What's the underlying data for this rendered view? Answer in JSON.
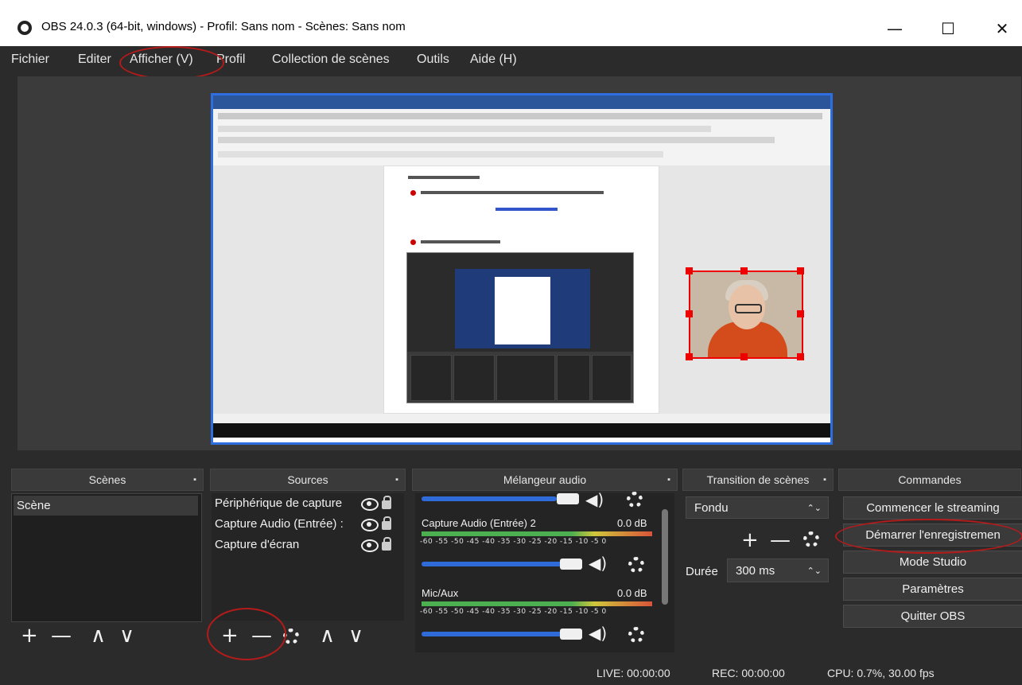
{
  "window": {
    "title": "OBS 24.0.3 (64-bit, windows) - Profil: Sans nom - Scènes: Sans nom",
    "minimize": "—",
    "maximize": "☐",
    "close": "✕"
  },
  "menu": [
    "Fichier",
    "Editer",
    "Afficher (V)",
    "Profil",
    "Collection de scènes",
    "Outils",
    "Aide (H)"
  ],
  "docks": {
    "scenes": {
      "title": "Scènes",
      "items": [
        "Scène"
      ]
    },
    "sources": {
      "title": "Sources",
      "items": [
        "Périphérique de capture",
        "Capture Audio (Entrée) :",
        "Capture d'écran"
      ]
    },
    "mixer": {
      "title": "Mélangeur audio",
      "channels": [
        {
          "name": "Capture Audio (Entrée) 2",
          "level": "0.0 dB"
        },
        {
          "name": "Mic/Aux",
          "level": "0.0 dB"
        }
      ],
      "ticks": "-60 -55 -50 -45 -40 -35 -30 -25 -20 -15 -10 -5 0"
    },
    "transitions": {
      "title": "Transition de scènes",
      "selected": "Fondu",
      "duration_label": "Durée",
      "duration_value": "300 ms"
    },
    "controls": {
      "title": "Commandes",
      "buttons": [
        "Commencer le streaming",
        "Démarrer l'enregistremen",
        "Mode Studio",
        "Paramètres",
        "Quitter OBS"
      ]
    }
  },
  "statusbar": {
    "live": "LIVE: 00:00:00",
    "rec": "REC: 00:00:00",
    "cpu": "CPU: 0.7%, 30.00 fps"
  },
  "toolbar_glyphs": {
    "add": "+",
    "remove": "—",
    "up": "∧",
    "down": "∨",
    "pin": "▪",
    "combo_arrows": "⌃⌄",
    "speaker": "◀)"
  }
}
